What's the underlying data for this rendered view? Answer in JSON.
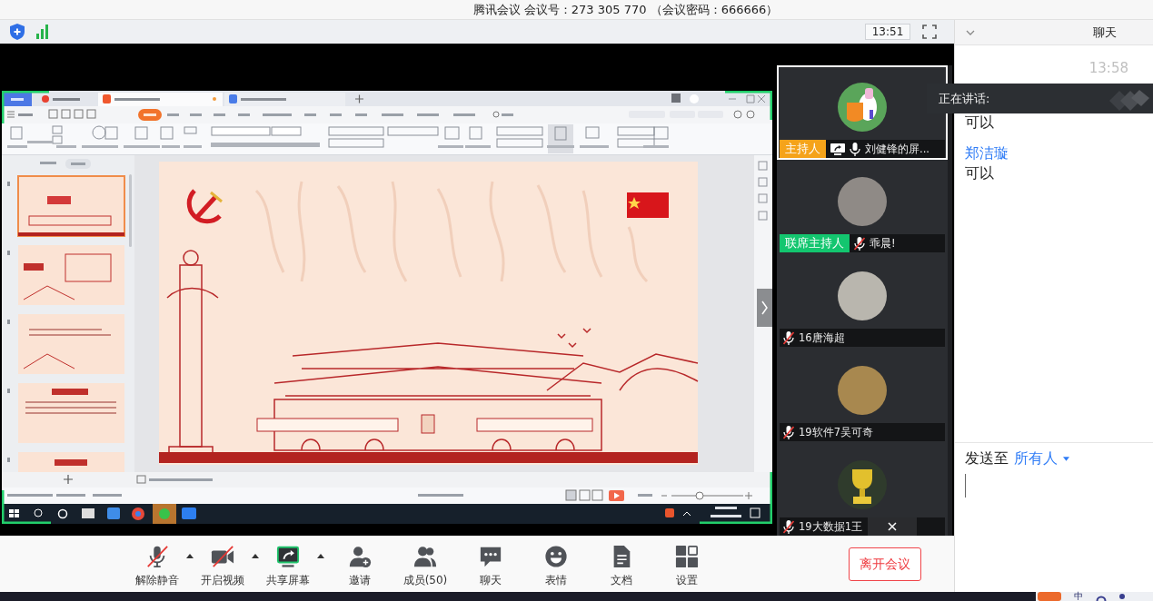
{
  "window": {
    "title": "腾讯会议 会议号：273 305 770 （会议密码：666666）"
  },
  "info_bar": {
    "time": "13:51"
  },
  "participants": [
    {
      "name": "刘健锋的屏...",
      "role": {
        "label": "主持人",
        "kind": "host"
      },
      "avatar": {
        "kind": "bird"
      },
      "sharing": true,
      "muted": false,
      "selected": true
    },
    {
      "name": "乖晨!",
      "role": {
        "label": "联席主持人",
        "kind": "cohost"
      },
      "avatar": {
        "kind": "photo"
      },
      "sharing": false,
      "muted": true,
      "selected": false
    },
    {
      "name": "16唐海超",
      "avatar": {
        "kind": "landscape"
      },
      "sharing": false,
      "muted": true,
      "selected": false
    },
    {
      "name": "19软件7吴可奇",
      "avatar": {
        "kind": "cartoon"
      },
      "sharing": false,
      "muted": true,
      "selected": false
    },
    {
      "name": "19大数据1王",
      "avatar": {
        "kind": "trophy"
      },
      "sharing": false,
      "muted": true,
      "selected": false
    }
  ],
  "speaking_tooltip": {
    "label": "正在讲话:"
  },
  "toolbar": {
    "items": [
      {
        "label": "解除静音",
        "kind": "mic",
        "off": true,
        "menu": true
      },
      {
        "label": "开启视频",
        "kind": "camera",
        "off": true,
        "menu": true
      },
      {
        "label": "共享屏幕",
        "kind": "share",
        "off": false,
        "menu": true
      },
      {
        "label": "邀请",
        "kind": "invite",
        "off": false,
        "menu": false
      },
      {
        "label": "成员(50)",
        "kind": "members",
        "off": false,
        "menu": false
      },
      {
        "label": "聊天",
        "kind": "chat",
        "off": false,
        "menu": false
      },
      {
        "label": "表情",
        "kind": "emoji",
        "off": false,
        "menu": false
      },
      {
        "label": "文档",
        "kind": "document",
        "off": false,
        "menu": false
      },
      {
        "label": "设置",
        "kind": "settings",
        "off": false,
        "menu": false
      }
    ],
    "leave": "离开会议"
  },
  "chat": {
    "title": "聊天",
    "time": "13:58",
    "messages": [
      {
        "text": "可以"
      },
      {
        "sender": "郑洁璇",
        "text": "可以"
      }
    ],
    "send_to": "发送至",
    "recipient": "所有人"
  },
  "desktop": {
    "input_indicator": "中"
  }
}
